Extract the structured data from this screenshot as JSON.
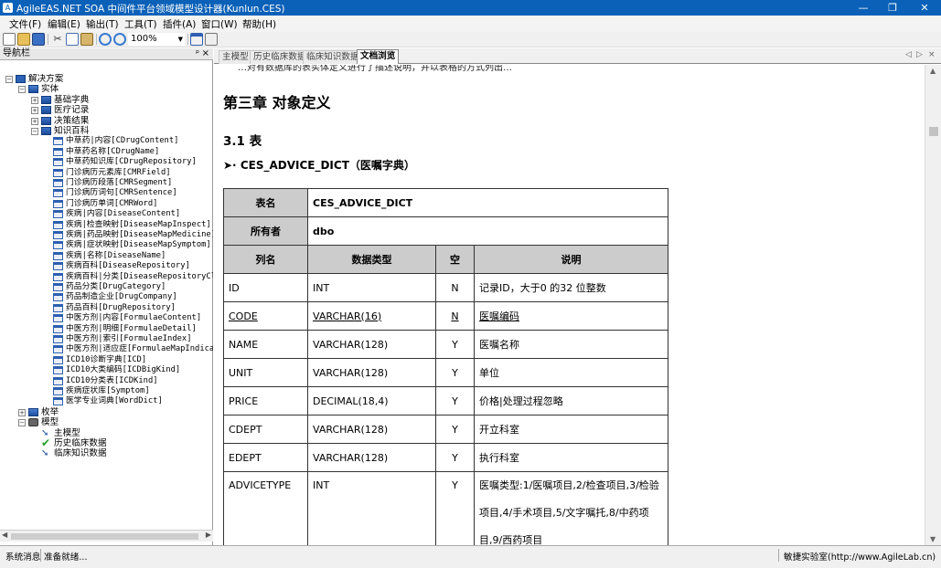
{
  "window": {
    "title": "AgileEAS.NET SOA 中间件平台领域模型设计器(Kunlun.CES)",
    "minimize": "—",
    "restore": "❐",
    "close": "✕"
  },
  "menu": [
    "文件(F)",
    "编辑(E)",
    "输出(T)",
    "工具(T)",
    "插件(A)",
    "窗口(W)",
    "帮助(H)"
  ],
  "toolbar": {
    "zoom_value": "100%",
    "icons": [
      "new-icon",
      "open-icon",
      "save-icon",
      "cut-icon",
      "copy-icon",
      "paste-icon",
      "zoom-in-icon",
      "zoom-out-icon",
      "layout-icon",
      "image-icon"
    ]
  },
  "nav": {
    "title": "导航栏",
    "pin": "ᵖ",
    "close": "×",
    "tree": [
      {
        "label": "解决方案",
        "icon": "solution",
        "expander": "−",
        "level": 0
      },
      {
        "label": "实体",
        "icon": "entity",
        "expander": "−",
        "level": 1
      },
      {
        "label": "基础字典",
        "icon": "module",
        "expander": "+",
        "level": 2
      },
      {
        "label": "医疗记录",
        "icon": "module",
        "expander": "+",
        "level": 2
      },
      {
        "label": "决策结果",
        "icon": "module",
        "expander": "+",
        "level": 2
      },
      {
        "label": "知识百科",
        "icon": "module",
        "expander": "−",
        "level": 2
      },
      {
        "label": "中草药|内容[CDrugContent]",
        "icon": "table",
        "level": 3
      },
      {
        "label": "中草药名称[CDrugName]",
        "icon": "table",
        "level": 3
      },
      {
        "label": "中草药知识库[CDrugRepository]",
        "icon": "table",
        "level": 3
      },
      {
        "label": "门诊病历元素库[CMRField]",
        "icon": "table",
        "level": 3
      },
      {
        "label": "门诊病历段落[CMRSegment]",
        "icon": "table",
        "level": 3
      },
      {
        "label": "门诊病历词句[CMRSentence]",
        "icon": "table",
        "level": 3
      },
      {
        "label": "门诊病历单词[CMRWord]",
        "icon": "table",
        "level": 3
      },
      {
        "label": "疾病|内容[DiseaseContent]",
        "icon": "table",
        "level": 3
      },
      {
        "label": "疾病|检查映射[DiseaseMapInspect]",
        "icon": "table",
        "level": 3
      },
      {
        "label": "疾病|药品映射[DiseaseMapMedicine]",
        "icon": "table",
        "level": 3
      },
      {
        "label": "疾病|症状映射[DiseaseMapSymptom]",
        "icon": "table",
        "level": 3
      },
      {
        "label": "疾病|名称[DiseaseName]",
        "icon": "table",
        "level": 3
      },
      {
        "label": "疾病百科[DiseaseRepository]",
        "icon": "table",
        "level": 3
      },
      {
        "label": "疾病百科|分类[DiseaseRepositoryClass]",
        "icon": "table",
        "level": 3
      },
      {
        "label": "药品分类[DrugCategory]",
        "icon": "table",
        "level": 3
      },
      {
        "label": "药品制造企业[DrugCompany]",
        "icon": "table",
        "level": 3
      },
      {
        "label": "药品百科[DrugRepository]",
        "icon": "table",
        "level": 3
      },
      {
        "label": "中医方剂|内容[FormulaeContent]",
        "icon": "table",
        "level": 3
      },
      {
        "label": "中医方剂|明细[FormulaeDetail]",
        "icon": "table",
        "level": 3
      },
      {
        "label": "中医方剂|索引[FormulaeIndex]",
        "icon": "table",
        "level": 3
      },
      {
        "label": "中医方剂|适应症[FormulaeMapIndication]",
        "icon": "table",
        "level": 3
      },
      {
        "label": "ICD10诊断字典[ICD]",
        "icon": "table",
        "level": 3
      },
      {
        "label": "ICD10大类编码[ICDBigKind]",
        "icon": "table",
        "level": 3
      },
      {
        "label": "ICD10分类表[ICDKind]",
        "icon": "table",
        "level": 3
      },
      {
        "label": "疾病症状库[Symptom]",
        "icon": "table",
        "level": 3
      },
      {
        "label": "医学专业词典[WordDict]",
        "icon": "table",
        "level": 3
      },
      {
        "label": "枚举",
        "icon": "entity",
        "expander": "+",
        "level": 1
      },
      {
        "label": "模型",
        "icon": "model",
        "expander": "−",
        "level": 1
      },
      {
        "label": "主模型",
        "icon": "arrow",
        "level": 2
      },
      {
        "label": "历史临床数据",
        "icon": "check",
        "level": 2
      },
      {
        "label": "临床知识数据",
        "icon": "arrow",
        "level": 2
      }
    ]
  },
  "tabs": [
    "主模型",
    "历史临床数据",
    "临床知识数据",
    "文档浏览"
  ],
  "active_tab": "文档浏览",
  "tab_nav": [
    "◁",
    "▷",
    "×"
  ],
  "doc": {
    "top_cut": "…对有数据库的表实体定义进行了描述说明，并以表格的方式列出…",
    "chapter": "第三章 对象定义",
    "section": "3.1  表",
    "table_heading_bullet": "➤·",
    "table_heading": "CES_ADVICE_DICT（医嘱字典）",
    "meta": [
      {
        "label": "表名",
        "value": "CES_ADVICE_DICT"
      },
      {
        "label": "所有者",
        "value": "dbo"
      }
    ],
    "headers": [
      "列名",
      "数据类型",
      "空",
      "说明"
    ],
    "rows": [
      {
        "name": "ID",
        "type": "INT",
        "nullable": "N",
        "desc": "记录ID，大于0 的32 位整数"
      },
      {
        "name": "CODE",
        "type": "VARCHAR(16)",
        "nullable": "N",
        "desc": "医嘱编码",
        "underline": true
      },
      {
        "name": "NAME",
        "type": "VARCHAR(128)",
        "nullable": "Y",
        "desc": "医嘱名称"
      },
      {
        "name": "UNIT",
        "type": "VARCHAR(128)",
        "nullable": "Y",
        "desc": "单位"
      },
      {
        "name": "PRICE",
        "type": "DECIMAL(18,4)",
        "nullable": "Y",
        "desc": "价格|处理过程忽略"
      },
      {
        "name": "CDEPT",
        "type": "VARCHAR(128)",
        "nullable": "Y",
        "desc": "开立科室"
      },
      {
        "name": "EDEPT",
        "type": "VARCHAR(128)",
        "nullable": "Y",
        "desc": "执行科室"
      },
      {
        "name": "ADVICETYPE",
        "type": "INT",
        "nullable": "Y",
        "desc": "医嘱类型:1/医嘱项目,2/检查项目,3/检验项目,4/手术项目,5/文字嘱托,8/中药项目,9/西药项目"
      }
    ]
  },
  "status": {
    "label": "系统消息",
    "message": "准备就绪...",
    "right": "敏捷实验室(http://www.AgileLab.cn)"
  },
  "colors": {
    "titlebar": "#0b61b8",
    "header_cell": "#cccccc"
  }
}
